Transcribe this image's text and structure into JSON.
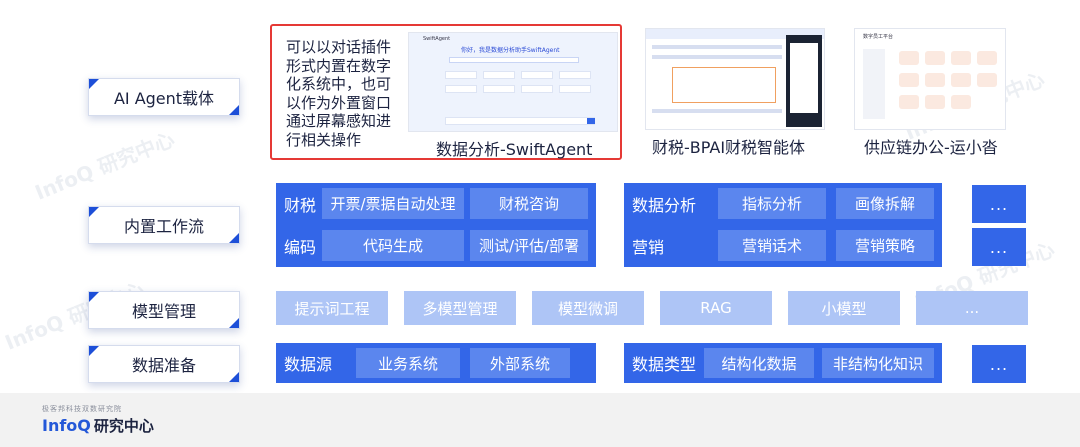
{
  "rows": {
    "agent_carrier": "AI Agent载体",
    "workflow": "内置工作流",
    "model_mgmt": "模型管理",
    "data_prep": "数据准备"
  },
  "carrier": {
    "description_lines": [
      "可以以对话插件",
      "形式内置在数字",
      "化系统中，也可",
      "以作为外置窗口",
      "通过屏幕感知进",
      "行相关操作"
    ],
    "swift_caption": "数据分析-SwiftAgent",
    "swift_window_title": "SwiftAgent",
    "swift_window_heading": "你好，我是数据分析助手SwiftAgent",
    "bpai_caption": "财税-BPAI财税智能体",
    "supply_caption": "供应链办公-运小沓",
    "supply_window_title": "数字员工平台"
  },
  "workflow": {
    "left": {
      "row1": {
        "title": "财税",
        "chips": [
          "开票/票据自动处理",
          "财税咨询"
        ]
      },
      "row2": {
        "title": "编码",
        "chips": [
          "代码生成",
          "测试/评估/部署"
        ]
      }
    },
    "right": {
      "row1": {
        "title": "数据分析",
        "chips": [
          "指标分析",
          "画像拆解"
        ]
      },
      "row2": {
        "title": "营销",
        "chips": [
          "营销话术",
          "营销策略"
        ]
      }
    },
    "more": [
      "...",
      "..."
    ]
  },
  "model_mgmt": {
    "chips": [
      "提示词工程",
      "多模型管理",
      "模型微调",
      "RAG",
      "小模型",
      "..."
    ]
  },
  "data_prep": {
    "left": {
      "title": "数据源",
      "chips": [
        "业务系统",
        "外部系统"
      ]
    },
    "right": {
      "title": "数据类型",
      "chips": [
        "结构化数据",
        "非结构化知识"
      ]
    },
    "more": "..."
  },
  "watermark": "InfoQ 研究中心",
  "footer": {
    "subtitle": "极客邦科技双数研究院",
    "brand": "InfoQ",
    "brand_cn": "研究中心"
  },
  "colors": {
    "primary": "#3366e8",
    "chip": "#5b86ee",
    "light_chip": "#aec5f6",
    "highlight_border": "#e53935",
    "label_accent": "#1d4fd8"
  }
}
